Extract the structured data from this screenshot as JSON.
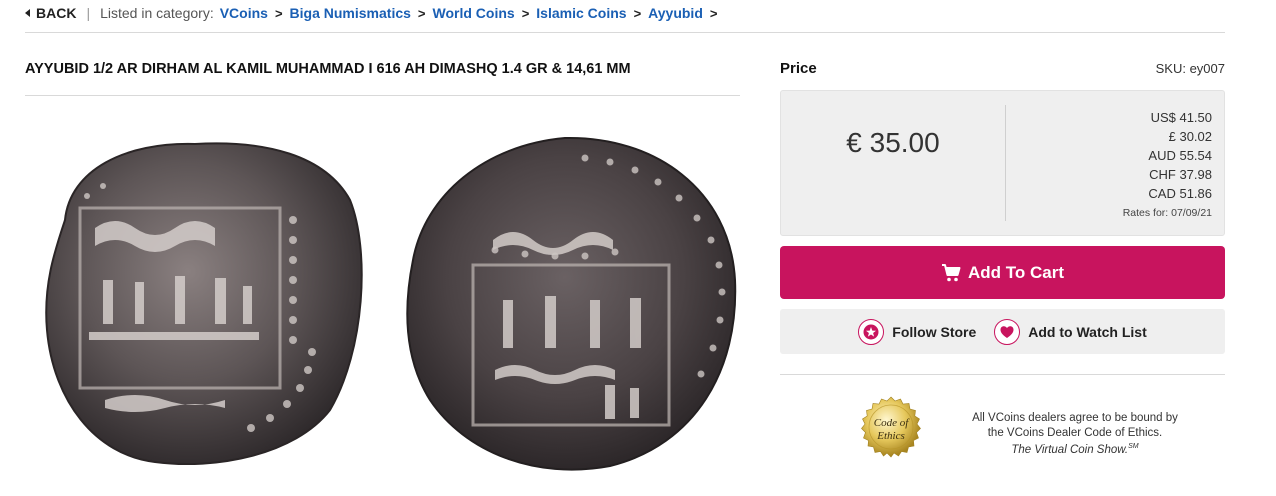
{
  "breadcrumb": {
    "back_label": "BACK",
    "listed_label": "Listed in category:",
    "items": [
      "VCoins",
      "Biga Numismatics",
      "World Coins",
      "Islamic Coins",
      "Ayyubid"
    ],
    "separator": ">"
  },
  "product": {
    "title": "AYYUBID 1/2 AR DIRHAM AL KAMIL MUHAMMAD I 616 AH DIMASHQ 1.4 GR & 14,61 MM"
  },
  "price": {
    "label": "Price",
    "sku": "SKU: ey007",
    "main": "€ 35.00",
    "conversions": [
      "US$ 41.50",
      "£ 30.02",
      "AUD 55.54",
      "CHF 37.98",
      "CAD 51.86"
    ],
    "rates_date": "Rates for: 07/09/21"
  },
  "actions": {
    "add_to_cart": "Add To Cart",
    "follow_store": "Follow Store",
    "watch_list": "Add to Watch List"
  },
  "ethics": {
    "seal_line1": "Code of",
    "seal_line2": "Ethics",
    "text": "All VCoins dealers agree to be bound by the VCoins Dealer Code of Ethics.",
    "show_name": "The Virtual Coin Show.",
    "show_mark": "SM"
  },
  "colors": {
    "accent": "#c8145e",
    "link": "#1a5fb4",
    "panel": "#efefef"
  },
  "icons": [
    "back-arrow-icon",
    "cart-icon",
    "star-icon",
    "heart-icon",
    "code-of-ethics-seal"
  ]
}
